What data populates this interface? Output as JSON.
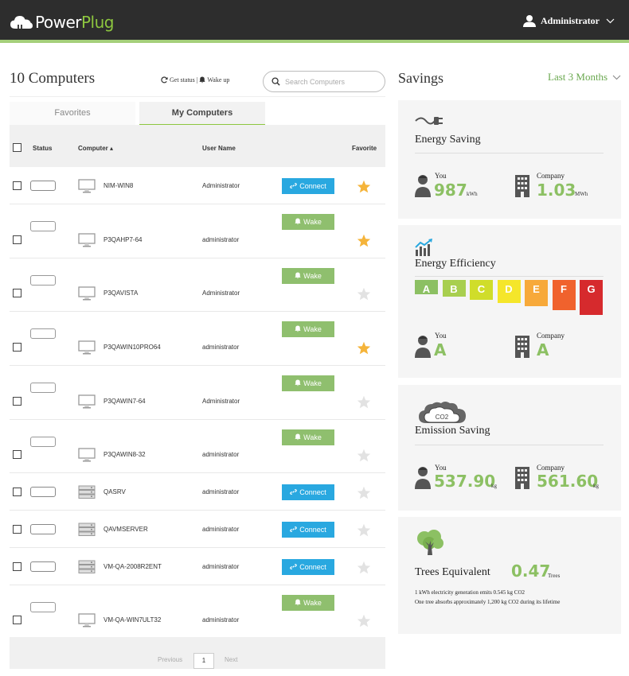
{
  "app": {
    "brand_prefix": "Power",
    "brand_suffix": "Plug",
    "user_name": "Administrator"
  },
  "computers": {
    "title": "10 Computers",
    "get_status": "Get status",
    "separator": "|",
    "wake_up": "Wake up",
    "search_placeholder": "Search Computers",
    "tabs": {
      "favorites": "Favorites",
      "my_computers": "My Computers"
    },
    "columns": {
      "status": "Status",
      "computer": "Computer",
      "user_name": "User Name",
      "favorite": "Favorite"
    },
    "rows": [
      {
        "name": "NIM-WIN8",
        "user": "Administrator",
        "action": "Connect",
        "online": true,
        "device": "desktop-icon",
        "favorite": true
      },
      {
        "name": "P3QAHP7-64",
        "user": "administrator",
        "action": "Wake",
        "online": false,
        "device": "desktop-icon",
        "favorite": true
      },
      {
        "name": "P3QAVISTA",
        "user": "Administrator",
        "action": "Wake",
        "online": false,
        "device": "desktop-icon",
        "favorite": false
      },
      {
        "name": "P3QAWIN10PRO64",
        "user": "administrator",
        "action": "Wake",
        "online": false,
        "device": "desktop-icon",
        "favorite": true
      },
      {
        "name": "P3QAWIN7-64",
        "user": "Administrator",
        "action": "Wake",
        "online": false,
        "device": "desktop-icon",
        "favorite": false
      },
      {
        "name": "P3QAWIN8-32",
        "user": "administrator",
        "action": "Wake",
        "online": false,
        "device": "desktop-icon",
        "favorite": false
      },
      {
        "name": "QASRV",
        "user": "administrator",
        "action": "Connect",
        "online": true,
        "device": "server-icon",
        "favorite": false
      },
      {
        "name": "QAVMSERVER",
        "user": "administrator",
        "action": "Connect",
        "online": true,
        "device": "server-icon",
        "favorite": false
      },
      {
        "name": "VM-QA-2008R2ENT",
        "user": "administrator",
        "action": "Connect",
        "online": true,
        "device": "server-icon",
        "favorite": false
      },
      {
        "name": "VM-QA-WIN7ULT32",
        "user": "administrator",
        "action": "Wake",
        "online": false,
        "device": "desktop-icon",
        "favorite": false
      }
    ],
    "pager": {
      "previous": "Previous",
      "page": "1",
      "next": "Next"
    }
  },
  "savings": {
    "title": "Savings",
    "period": "Last 3 Months",
    "you_label": "You",
    "company_label": "Company",
    "energy_saving": {
      "title": "Energy Saving",
      "you_value": "987",
      "you_unit": "kWh",
      "company_value": "1.03",
      "company_unit": "MWh"
    },
    "energy_efficiency": {
      "title": "Energy Efficiency",
      "grades": [
        "A",
        "B",
        "C",
        "D",
        "E",
        "F",
        "G"
      ],
      "grade_colors": [
        "#8cc063",
        "#a8cf4f",
        "#d0dd2a",
        "#f5e62a",
        "#f7a93a",
        "#f0622d",
        "#d62a2d"
      ],
      "you_value": "A",
      "company_value": "A"
    },
    "emission_saving": {
      "title": "Emission Saving",
      "cloud_label": "CO2",
      "you_value": "537.90",
      "you_unit": "kg",
      "company_value": "561.60",
      "company_unit": "kg"
    },
    "trees": {
      "title": "Trees Equivalent",
      "value": "0.47",
      "unit": "Trees",
      "note1": "1 kWh electricity generation emits 0.545 kg CO2",
      "note2": "One tree absorbs approximately 1,200 kg CO2 during its lifetime"
    }
  },
  "colors": {
    "accent_green": "#8cc063",
    "connect_blue": "#29a8e0",
    "wake_green": "#8fbf6e",
    "star_gold": "#f5b43a",
    "star_grey": "#e2e2e2"
  }
}
